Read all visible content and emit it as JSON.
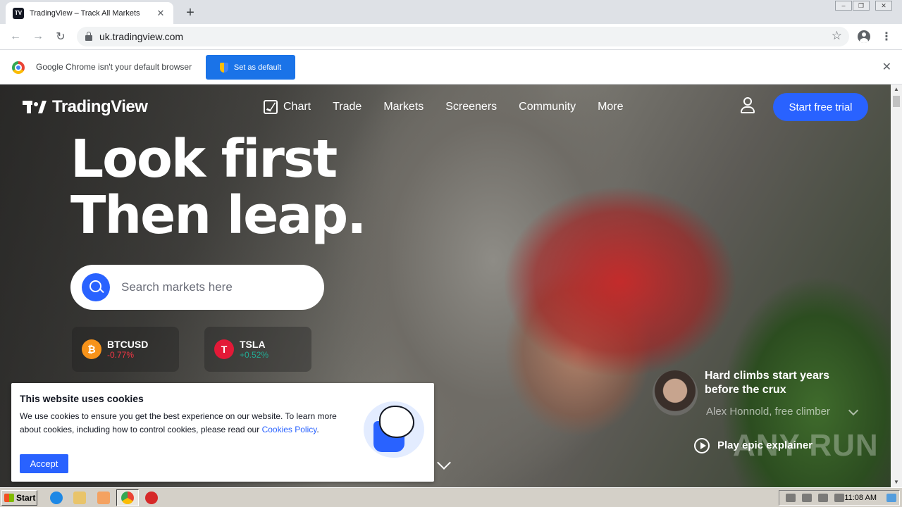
{
  "browser": {
    "tab_title": "TradingView – Track All Markets",
    "url": "uk.tradingview.com",
    "infobar_text": "Google Chrome isn't your default browser",
    "set_default_label": "Set as default"
  },
  "nav": {
    "logo_text": "TradingView",
    "items": [
      "Chart",
      "Trade",
      "Markets",
      "Screeners",
      "Community",
      "More"
    ],
    "cta": "Start free trial"
  },
  "hero": {
    "line1": "Look first",
    "line2": "Then leap.",
    "search_placeholder": "Search markets here"
  },
  "tickers": [
    {
      "symbol": "BTCUSD",
      "change": "-0.77%",
      "color": "#f23645",
      "icon_color": "#f7931a",
      "icon_glyph": "₿"
    },
    {
      "symbol": "TSLA",
      "change": "+0.52%",
      "color": "#22ab94",
      "icon_color": "#e31937",
      "icon_glyph": "T"
    }
  ],
  "quote": {
    "text": "Hard climbs start years before the crux",
    "author": "Alex Honnold, free climber",
    "play_label": "Play epic explainer"
  },
  "watermark": "ANY RUN",
  "cookie": {
    "title": "This website uses cookies",
    "body": "We use cookies to ensure you get the best experience on our website. To learn more about cookies, including how to control cookies, please read our",
    "link": "Cookies Policy",
    "tail": ".",
    "accept": "Accept"
  },
  "taskbar": {
    "start": "Start",
    "clock": "11:08 AM"
  },
  "colors": {
    "brand_blue": "#2962ff",
    "chrome_blue": "#1a73e8"
  }
}
